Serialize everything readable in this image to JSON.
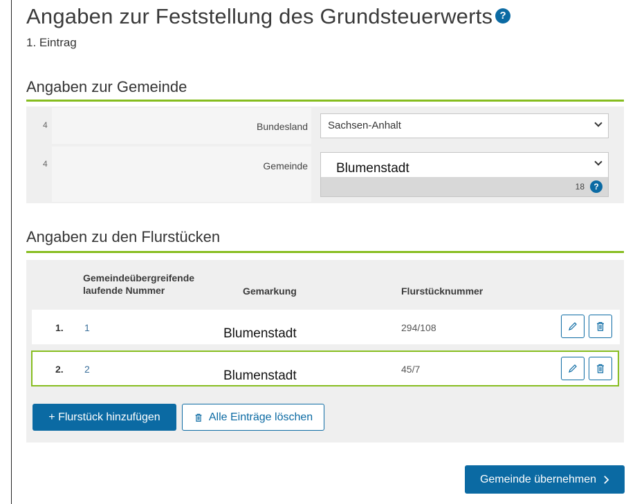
{
  "header": {
    "title": "Angaben zur Feststellung des Grundsteuerwerts",
    "help": "?",
    "subtitle": "1. Eintrag"
  },
  "gemeinde_section": {
    "heading": "Angaben zur Gemeinde",
    "rows": [
      {
        "number": "4",
        "label": "Bundesland",
        "value": "Sachsen-Anhalt"
      },
      {
        "number": "4",
        "label": "Gemeinde",
        "value": "Blumenstadt",
        "counter": "18",
        "help": "?"
      }
    ]
  },
  "flurstuecke_section": {
    "heading": "Angaben zu den Flurstücken",
    "columns": {
      "lfd_line1": "Gemeindeübergreifende",
      "lfd_line2": "laufende Nummer",
      "gemarkung": "Gemarkung",
      "flurstueck": "Flurstücknummer"
    },
    "rows": [
      {
        "index": "1.",
        "lfd": "1",
        "gemarkung": "Blumenstadt",
        "flurstueck": "294/108"
      },
      {
        "index": "2.",
        "lfd": "2",
        "gemarkung": "Blumenstadt",
        "flurstueck": "45/7"
      }
    ],
    "add_button": "+ Flurstück hinzufügen",
    "delete_all_button": "Alle Einträge löschen"
  },
  "footer": {
    "submit_button": "Gemeinde übernehmen"
  },
  "icons": {
    "edit": "pencil-icon",
    "delete": "trash-icon",
    "select": "chevron-down-icon",
    "next": "chevron-right-icon"
  },
  "colors": {
    "accent_green": "#86bd1f",
    "primary_blue": "#0b6aa3"
  }
}
